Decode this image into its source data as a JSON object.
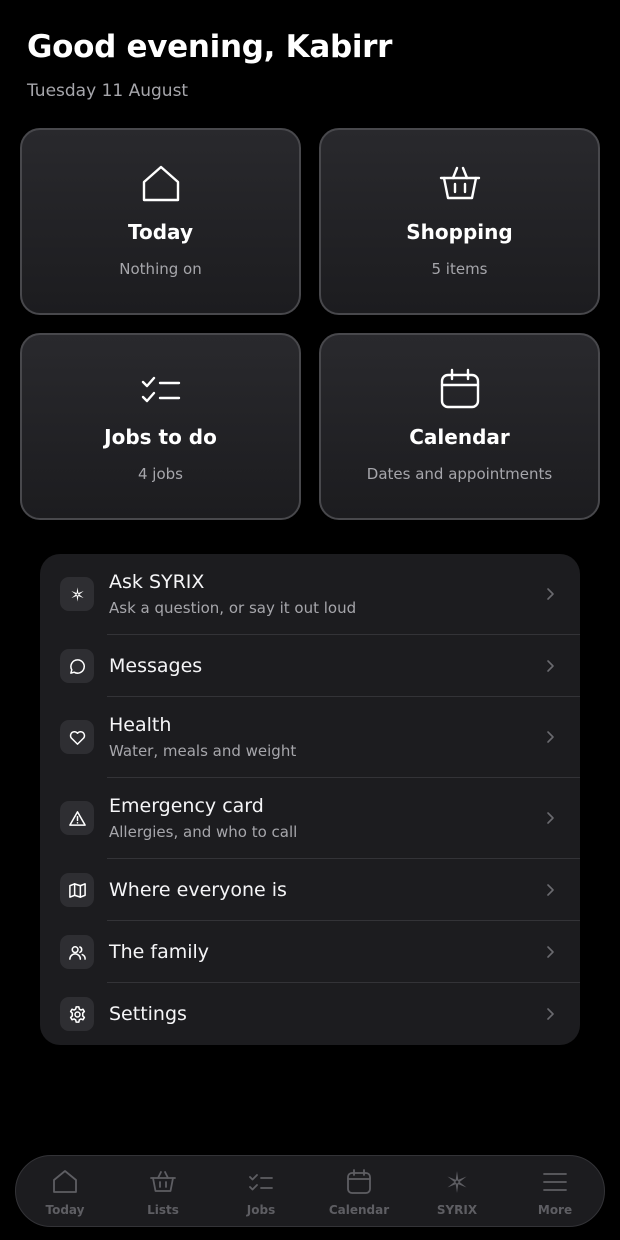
{
  "header": {
    "greeting": "Good evening, Kabirr",
    "date": "Tuesday 11 August"
  },
  "tiles": [
    {
      "title": "Today",
      "subtitle": "Nothing on",
      "icon": "home-icon"
    },
    {
      "title": "Shopping",
      "subtitle": "5 items",
      "icon": "basket-icon"
    },
    {
      "title": "Jobs to do",
      "subtitle": "4 jobs",
      "icon": "checklist-icon"
    },
    {
      "title": "Calendar",
      "subtitle": "Dates and appointments",
      "icon": "calendar-icon"
    }
  ],
  "menu": [
    {
      "title": "Ask SYRIX",
      "subtitle": "Ask a question, or say it out loud",
      "icon": "sparkle-icon"
    },
    {
      "title": "Messages",
      "subtitle": "",
      "icon": "chat-bubble-icon"
    },
    {
      "title": "Health",
      "subtitle": "Water, meals and weight",
      "icon": "heart-icon"
    },
    {
      "title": "Emergency card",
      "subtitle": "Allergies, and who to call",
      "icon": "warning-icon"
    },
    {
      "title": "Where everyone is",
      "subtitle": "",
      "icon": "map-icon"
    },
    {
      "title": "The family",
      "subtitle": "",
      "icon": "people-icon"
    },
    {
      "title": "Settings",
      "subtitle": "",
      "icon": "gear-icon"
    }
  ],
  "tabbar": [
    {
      "label": "Today",
      "icon": "home-icon"
    },
    {
      "label": "Lists",
      "icon": "basket-icon"
    },
    {
      "label": "Jobs",
      "icon": "checklist-icon"
    },
    {
      "label": "Calendar",
      "icon": "calendar-icon"
    },
    {
      "label": "SYRIX",
      "icon": "sparkle-icon"
    },
    {
      "label": "More",
      "icon": "menu-icon"
    }
  ],
  "colors": {
    "background": "#000000",
    "surface": "#1c1c1f",
    "text_primary": "#ffffff",
    "text_secondary": "#a6a6ab",
    "tab_inactive": "#5e5e63"
  }
}
